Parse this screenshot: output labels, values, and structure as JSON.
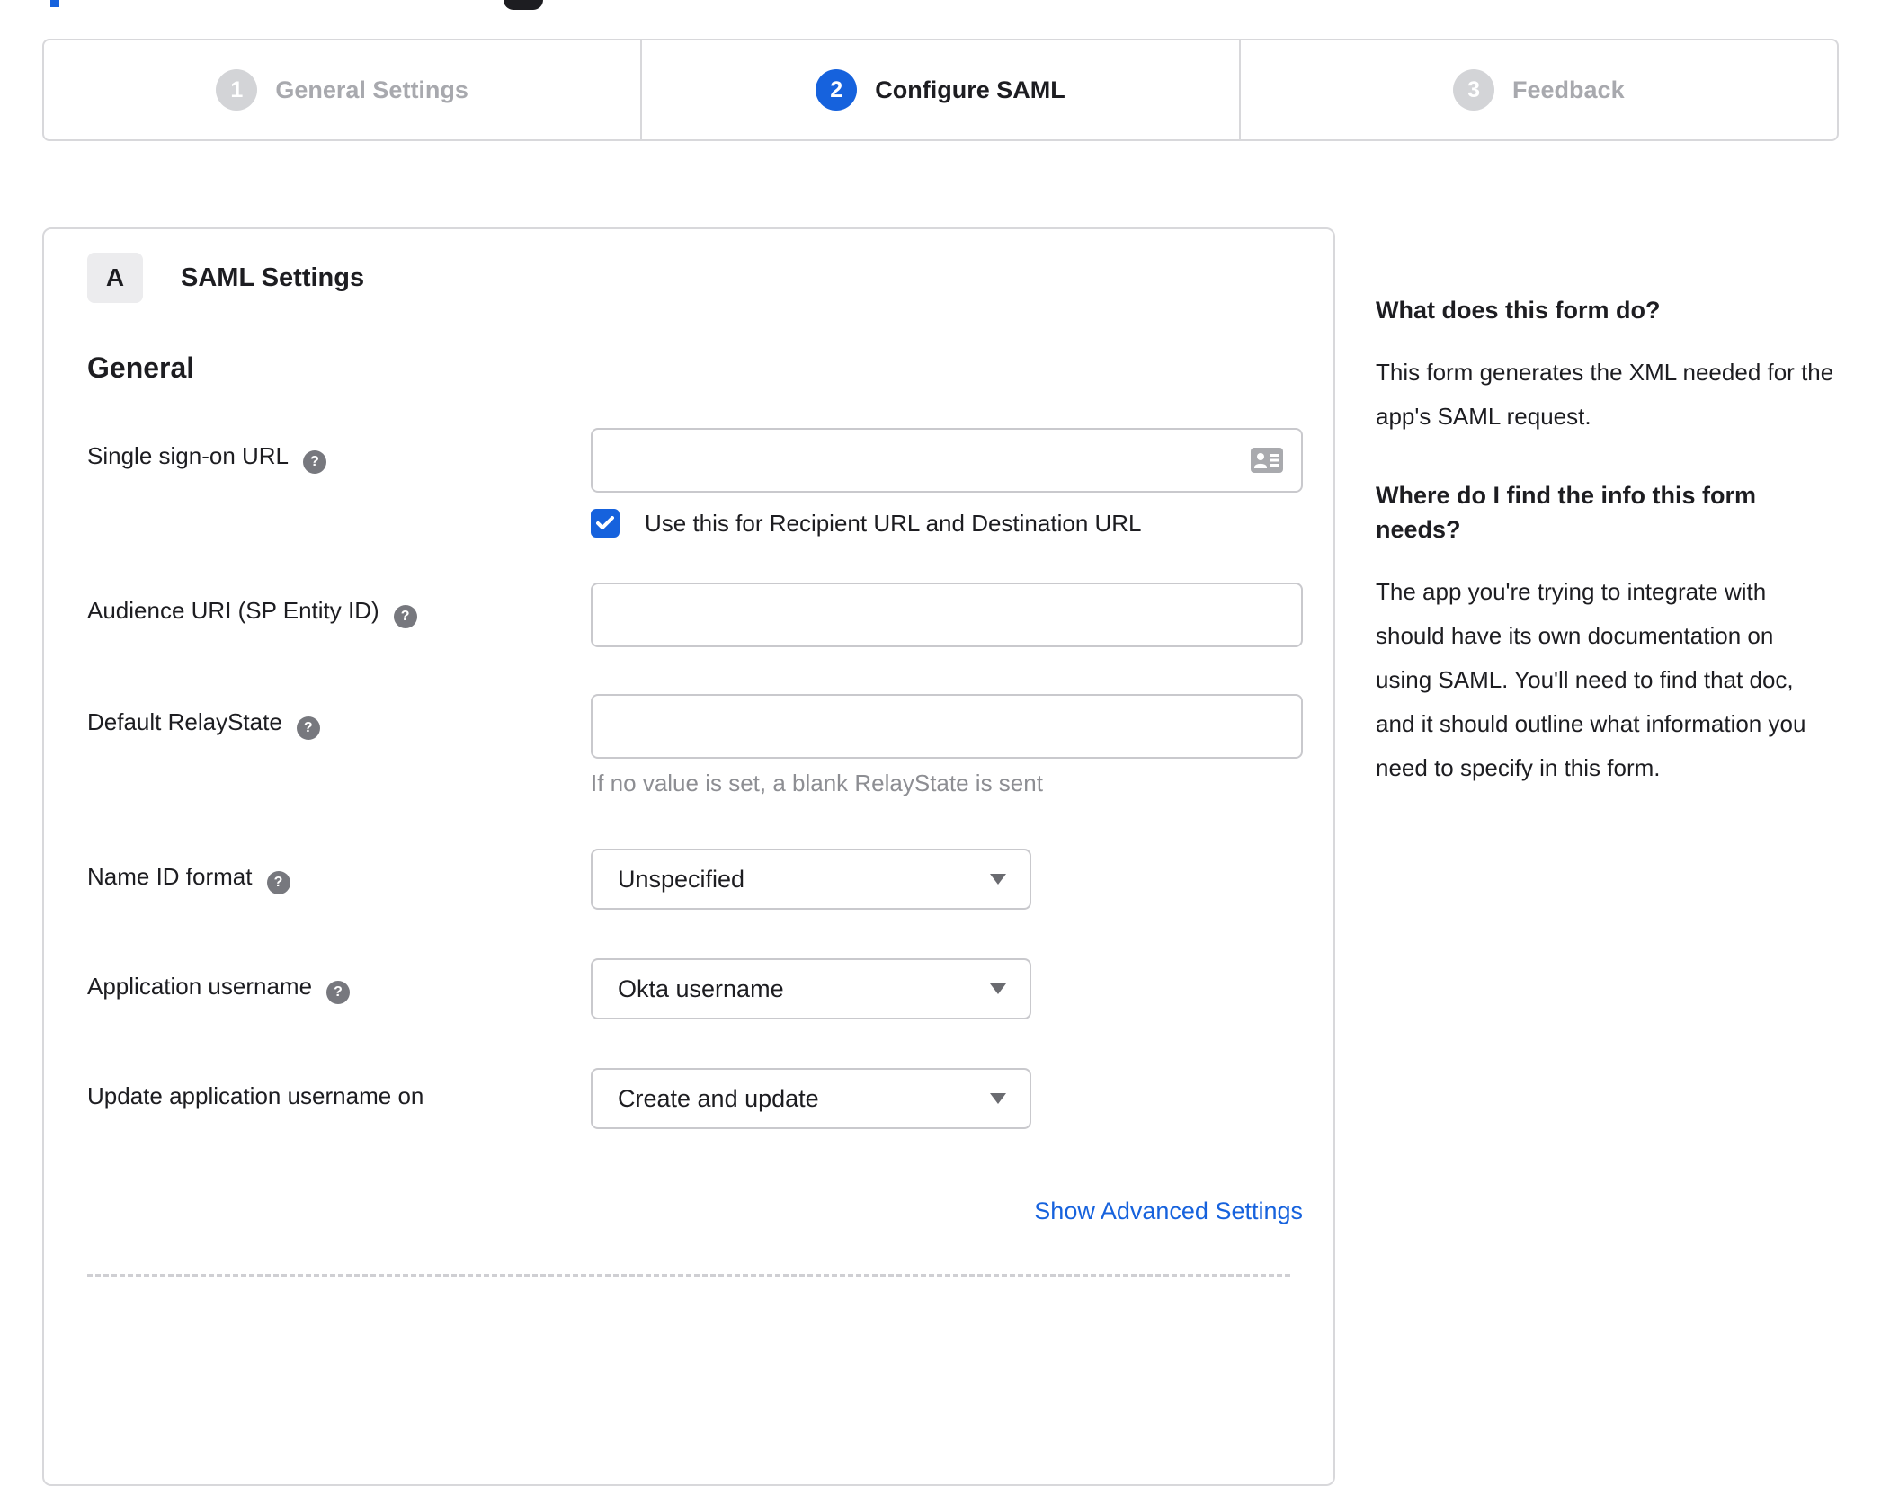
{
  "stepper": {
    "steps": [
      {
        "number": "1",
        "label": "General Settings",
        "state": "inactive"
      },
      {
        "number": "2",
        "label": "Configure SAML",
        "state": "active"
      },
      {
        "number": "3",
        "label": "Feedback",
        "state": "inactive"
      }
    ]
  },
  "panel": {
    "badge": "A",
    "title": "SAML Settings",
    "section_heading": "General",
    "help_glyph": "?",
    "fields": [
      {
        "label": "Single sign-on URL",
        "value": "",
        "checkbox_label": "Use this for Recipient URL and Destination URL",
        "checkbox_checked": true
      },
      {
        "label": "Audience URI (SP Entity ID)",
        "value": ""
      },
      {
        "label": "Default RelayState",
        "value": "",
        "hint": "If no value is set, a blank RelayState is sent"
      },
      {
        "label": "Name ID format",
        "value": "Unspecified"
      },
      {
        "label": "Application username",
        "value": "Okta username"
      },
      {
        "label": "Update application username on",
        "value": "Create and update"
      }
    ],
    "advanced_link": "Show Advanced Settings"
  },
  "sidebar": {
    "sections": [
      {
        "heading": "What does this form do?",
        "body": "This form generates the XML needed for the app's SAML request."
      },
      {
        "heading": "Where do I find the info this form needs?",
        "body": "The app you're trying to integrate with should have its own documentation on using SAML. You'll need to find that doc, and it should outline what information you need to specify in this form."
      }
    ]
  },
  "colors": {
    "accent_blue": "#1662dd",
    "text_dark": "#1d1d21",
    "text_muted": "#8d8e93",
    "border_gray": "#d8d8db",
    "inactive_step_gray": "#d3d4d7"
  }
}
